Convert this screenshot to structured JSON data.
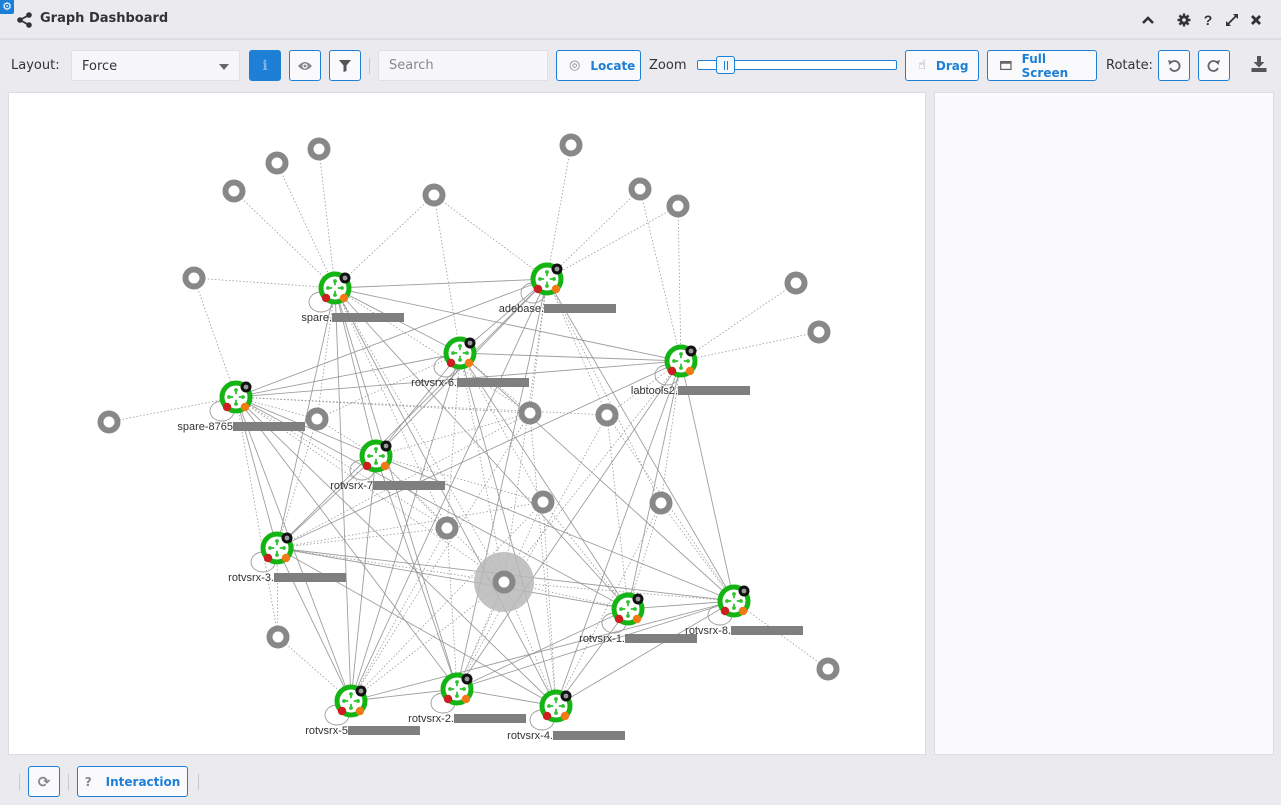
{
  "window": {
    "title": "Graph Dashboard",
    "actions": [
      "collapse",
      "settings",
      "help",
      "expand",
      "close"
    ]
  },
  "toolbar": {
    "layout_label": "Layout:",
    "layout_value": "Force",
    "info_button": "i",
    "search_placeholder": "Search",
    "search_value": "",
    "locate_label": "Locate",
    "zoom_label": "Zoom",
    "zoom_level": 0.1,
    "drag_label": "Drag",
    "fullscreen_label": "Full Screen",
    "rotate_label": "Rotate:"
  },
  "footer": {
    "refresh_label": "",
    "interaction_label": "Interaction",
    "interaction_icon": "?"
  },
  "graph": {
    "colors": {
      "router_ring": "#15b415",
      "router_arrows": "#2fc42f",
      "badge_black": "#111111",
      "badge_red": "#cc1f1f",
      "badge_orange": "#f07a14",
      "endpoint": "#888888",
      "edge": "#8e8e8e",
      "accent": "#1d7fd6"
    },
    "routers": [
      {
        "id": "spare",
        "label": "spare."
      },
      {
        "id": "adebase",
        "label": "adebase."
      },
      {
        "id": "rotvsrx-6",
        "label": "rotvsrx-6."
      },
      {
        "id": "labtools2",
        "label": "labtools2."
      },
      {
        "id": "spare-8765",
        "label": "spare-8765"
      },
      {
        "id": "rotvsrx-7",
        "label": "rotvsrx-7"
      },
      {
        "id": "rotvsrx-3",
        "label": "rotvsrx-3."
      },
      {
        "id": "rotvsrx-1",
        "label": "rotvsrx-1."
      },
      {
        "id": "rotvsrx-8",
        "label": "rotvsrx-8."
      },
      {
        "id": "rotvsrx-5",
        "label": "rotvsrx-5"
      },
      {
        "id": "rotvsrx-2",
        "label": "rotvsrx-2."
      },
      {
        "id": "rotvsrx-4",
        "label": "rotvsrx-4."
      }
    ],
    "endpoint_count": 21,
    "highlighted_endpoint": "center-endpoint"
  }
}
